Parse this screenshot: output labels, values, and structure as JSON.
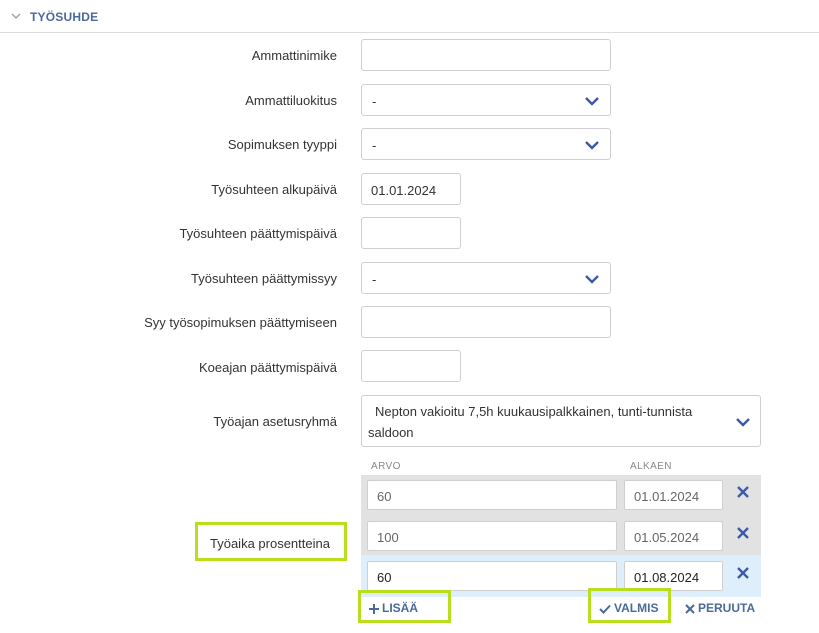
{
  "section": {
    "title": "TYÖSUHDE",
    "icon": "chevron-down-icon"
  },
  "fields": {
    "ammattinimike": {
      "label": "Ammattinimike",
      "value": ""
    },
    "ammattiluokitus": {
      "label": "Ammattiluokitus",
      "value": "-"
    },
    "sopimuksen_tyyppi": {
      "label": "Sopimuksen tyyppi",
      "value": "-"
    },
    "alkupaiva": {
      "label": "Työsuhteen alkupäivä",
      "value": "01.01.2024"
    },
    "paattymispaiva": {
      "label": "Työsuhteen päättymispäivä",
      "value": ""
    },
    "paattymissyy": {
      "label": "Työsuhteen päättymissyy",
      "value": "-"
    },
    "syy_paattymiseen": {
      "label": "Syy työsopimuksen päättymiseen",
      "value": ""
    },
    "koeaika": {
      "label": "Koeajan päättymispäivä",
      "value": ""
    },
    "tyoaika_ryhma": {
      "label": "Työajan asetusryhmä",
      "value_line1": "Nepton vakioitu 7,5h kuukausipalkkainen, tunti-tunnista",
      "value_line2": "saldoon"
    }
  },
  "tyoaika_prosentteina": {
    "label": "Työaika prosentteina",
    "columns": {
      "arvo": "ARVO",
      "alkaen": "ALKAEN"
    },
    "rows": [
      {
        "arvo": "60",
        "alkaen": "01.01.2024"
      },
      {
        "arvo": "100",
        "alkaen": "01.05.2024"
      },
      {
        "arvo": "60",
        "alkaen": "01.08.2024"
      }
    ],
    "add_label": "LISÄÄ",
    "done_label": "VALMIS",
    "cancel_label": "PERUUTA"
  },
  "colors": {
    "accent": "#4a6a9a",
    "highlight": "#b9de1e",
    "row_gray": "#e2e2e2",
    "row_active": "#deeefa",
    "icon_blue": "#3d5aa8"
  }
}
